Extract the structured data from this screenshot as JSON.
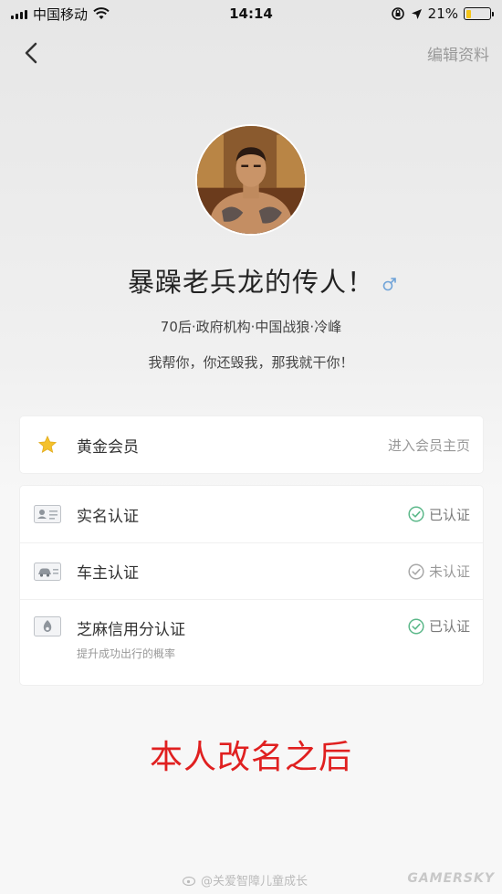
{
  "status_bar": {
    "carrier": "中国移动",
    "time": "14:14",
    "battery": "21%",
    "battery_level": 0.21
  },
  "nav": {
    "edit_label": "编辑资料"
  },
  "profile": {
    "name": "暴躁老兵龙的传人！",
    "gender_icon": "male-icon",
    "tags": "70后·政府机构·中国战狼·冷峰",
    "signature": "我帮你，你还毁我，那我就干你！"
  },
  "membership": {
    "label": "黄金会员",
    "link": "进入会员主页",
    "icon": "star-icon"
  },
  "verifications": [
    {
      "label": "实名认证",
      "status": "已认证",
      "icon": "id-card-icon",
      "verified": true
    },
    {
      "label": "车主认证",
      "status": "未认证",
      "icon": "car-card-icon",
      "verified": false
    },
    {
      "label": "芝麻信用分认证",
      "sub": "提升成功出行的概率",
      "status": "已认证",
      "icon": "sesame-credit-icon",
      "verified": true
    }
  ],
  "annotation": "本人改名之后",
  "watermark": {
    "left": "@关爱智障儿童成长",
    "right": "GAMERSKY"
  },
  "colors": {
    "accent_green": "#5cb88a",
    "star_yellow": "#f4c12c",
    "annotation_red": "#e02020",
    "gender_blue": "#6fa3d8"
  }
}
